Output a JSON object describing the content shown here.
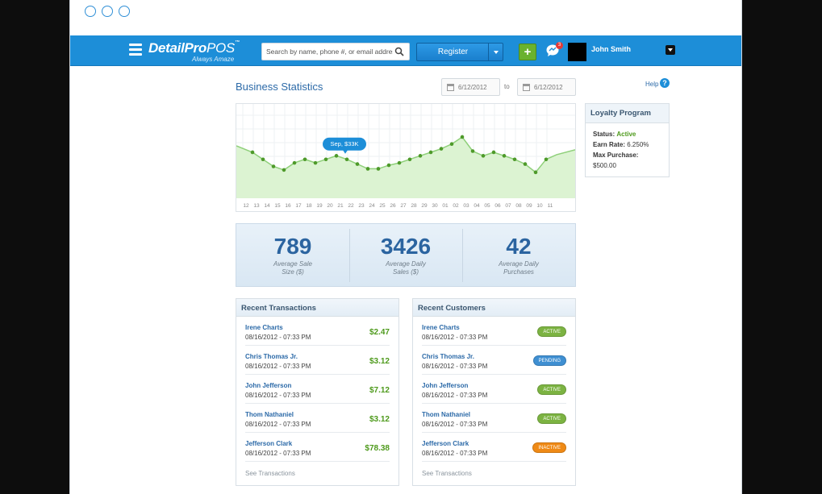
{
  "app": {
    "logo_main": "DetailPro",
    "logo_suffix": "POS",
    "logo_tm": "™",
    "logo_tagline": "Always Amaze"
  },
  "topbar": {
    "search_placeholder": "Search by name, phone #, or email address",
    "register_label": "Register",
    "plus_label": "+",
    "chat_badge": "3",
    "user_name": "John Smith"
  },
  "page": {
    "title": "Business Statistics",
    "date_from": "6/12/2012",
    "date_sep": "to",
    "date_to": "6/12/2012",
    "help_label": "Help",
    "help_icon": "?"
  },
  "chart_data": {
    "type": "area",
    "x_labels": [
      "12",
      "13",
      "14",
      "15",
      "16",
      "17",
      "18",
      "19",
      "20",
      "21",
      "22",
      "23",
      "24",
      "25",
      "26",
      "27",
      "28",
      "29",
      "30",
      "01",
      "02",
      "03",
      "04",
      "05",
      "06",
      "07",
      "08",
      "09",
      "10",
      "11"
    ],
    "values": [
      39,
      33,
      27,
      24,
      30,
      33,
      30,
      33,
      36,
      33,
      29,
      25,
      25,
      28,
      30,
      33,
      36,
      39,
      42,
      46,
      52,
      40,
      36,
      39,
      36,
      33,
      29,
      22,
      33,
      37
    ],
    "tooltip_text": "Sep, $33K",
    "tooltip_index": 9,
    "ylim": [
      0,
      80
    ],
    "grid": true,
    "colors": {
      "line": "#8fd07a",
      "fill": "#dcf3d2",
      "point": "#4e9a2a",
      "tooltip": "#1d8ed8"
    }
  },
  "loyalty": {
    "title": "Loyalty Program",
    "status_label": "Status:",
    "status_value": "Active",
    "earn_label": "Earn Rate:",
    "earn_value": "6.250%",
    "max_label": "Max Purchase:",
    "max_value": "$500.00"
  },
  "stats": [
    {
      "value": "789",
      "label_line1": "Average Sale",
      "label_line2": "Size ($)"
    },
    {
      "value": "3426",
      "label_line1": "Average Daily",
      "label_line2": "Sales ($)"
    },
    {
      "value": "42",
      "label_line1": "Average Daily",
      "label_line2": "Purchases"
    }
  ],
  "transactions": {
    "title": "Recent Transactions",
    "rows": [
      {
        "name": "Irene Charts",
        "date": "08/16/2012 - 07:33 PM",
        "amount": "$2.47"
      },
      {
        "name": "Chris Thomas Jr.",
        "date": "08/16/2012 - 07:33 PM",
        "amount": "$3.12"
      },
      {
        "name": "John Jefferson",
        "date": "08/16/2012 - 07:33 PM",
        "amount": "$7.12"
      },
      {
        "name": "Thom Nathaniel",
        "date": "08/16/2012 - 07:33 PM",
        "amount": "$3.12"
      },
      {
        "name": "Jefferson Clark",
        "date": "08/16/2012 - 07:33 PM",
        "amount": "$78.38"
      }
    ],
    "see_link": "See Transactions"
  },
  "customers": {
    "title": "Recent Customers",
    "rows": [
      {
        "name": "Irene Charts",
        "date": "08/16/2012 - 07:33 PM",
        "status": "ACTIVE",
        "color": "#7cb342"
      },
      {
        "name": "Chris Thomas Jr.",
        "date": "08/16/2012 - 07:33 PM",
        "status": "PENDING",
        "color": "#3f8fd2"
      },
      {
        "name": "John Jefferson",
        "date": "08/16/2012 - 07:33 PM",
        "status": "ACTIVE",
        "color": "#7cb342"
      },
      {
        "name": "Thom Nathaniel",
        "date": "08/16/2012 - 07:33 PM",
        "status": "ACTIVE",
        "color": "#7cb342"
      },
      {
        "name": "Jefferson Clark",
        "date": "08/16/2012 - 07:33 PM",
        "status": "INACTIVE",
        "color": "#ef8a16"
      }
    ],
    "see_link": "See Transactions"
  }
}
